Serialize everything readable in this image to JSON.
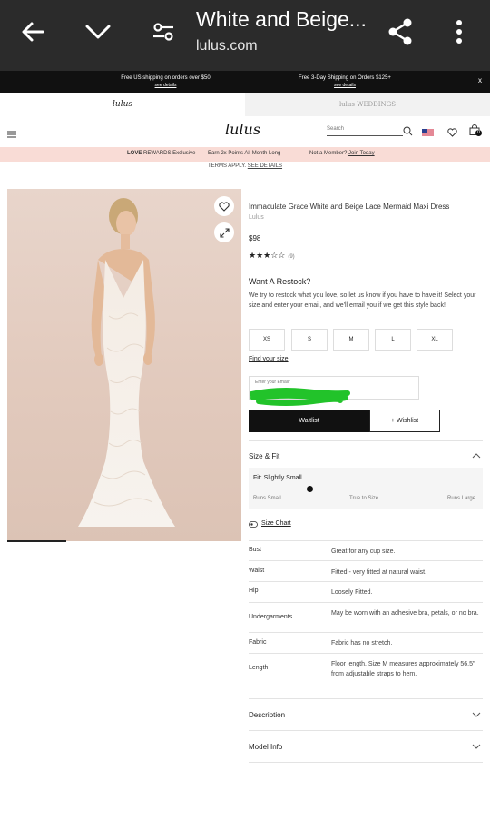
{
  "browser": {
    "title": "White and Beige...",
    "url": "lulus.com"
  },
  "promo": {
    "left_text": "Free US shipping on orders over $50",
    "left_link": "see details",
    "right_text": "Free 3-Day Shipping on Orders $125+",
    "right_link": "see details",
    "close": "x"
  },
  "brand_tabs": {
    "primary": "lulus",
    "secondary": "lulus WEDDINGS"
  },
  "nav": {
    "logo": "lulus",
    "search_placeholder": "Search",
    "cart_count": "0"
  },
  "rewards": {
    "brand": "LOVE",
    "brand_suffix": "REWARDS Exclusive",
    "offer": "Earn 2x Points All Month Long",
    "member_text": "Not a Member?",
    "join_link": "Join Today"
  },
  "terms": {
    "text": "TERMS APPLY.",
    "link": "SEE DETAILS"
  },
  "product": {
    "name": "Immaculate Grace White and Beige Lace Mermaid Maxi Dress",
    "brand": "Lulus",
    "price": "$98",
    "rating": 3.5,
    "rating_stars": "★★★☆☆",
    "review_count": "(9)"
  },
  "restock": {
    "title": "Want A Restock?",
    "text": "We try to restock what you love, so let us know if you have to have it! Select your size and enter your email, and we'll email you if we get this style back!",
    "sizes": [
      "XS",
      "S",
      "M",
      "L",
      "XL"
    ],
    "find_size": "Find your size",
    "email_label": "Enter your Email*",
    "waitlist_label": "Waitlist",
    "wishlist_label": "+ Wishlist"
  },
  "size_fit": {
    "title": "Size & Fit",
    "fit_label": "Fit: Slightly Small",
    "fit_level": 0.25,
    "scale_labels": [
      "Runs Small",
      "True to Size",
      "Runs Large"
    ],
    "size_chart": "Size Chart",
    "rows": [
      {
        "k": "Bust",
        "v": "Great for any cup size."
      },
      {
        "k": "Waist",
        "v": "Fitted - very fitted at natural waist."
      },
      {
        "k": "Hip",
        "v": "Loosely Fitted."
      },
      {
        "k": "Undergarments",
        "v": "May be worn with an adhesive bra, petals, or no bra."
      },
      {
        "k": "Fabric",
        "v": "Fabric has no stretch."
      },
      {
        "k": "Length",
        "v": "Floor length. Size M measures approximately 56.5\" from adjustable straps to hem."
      }
    ]
  },
  "sections": {
    "description": "Description",
    "model_info": "Model Info"
  },
  "colors": {
    "browser_bar": "#2b2b2b",
    "promo_bar": "#111111",
    "rewards_bar": "#f9dcd6",
    "photo_bg": "#e2cabd",
    "redaction": "#22c32a"
  }
}
